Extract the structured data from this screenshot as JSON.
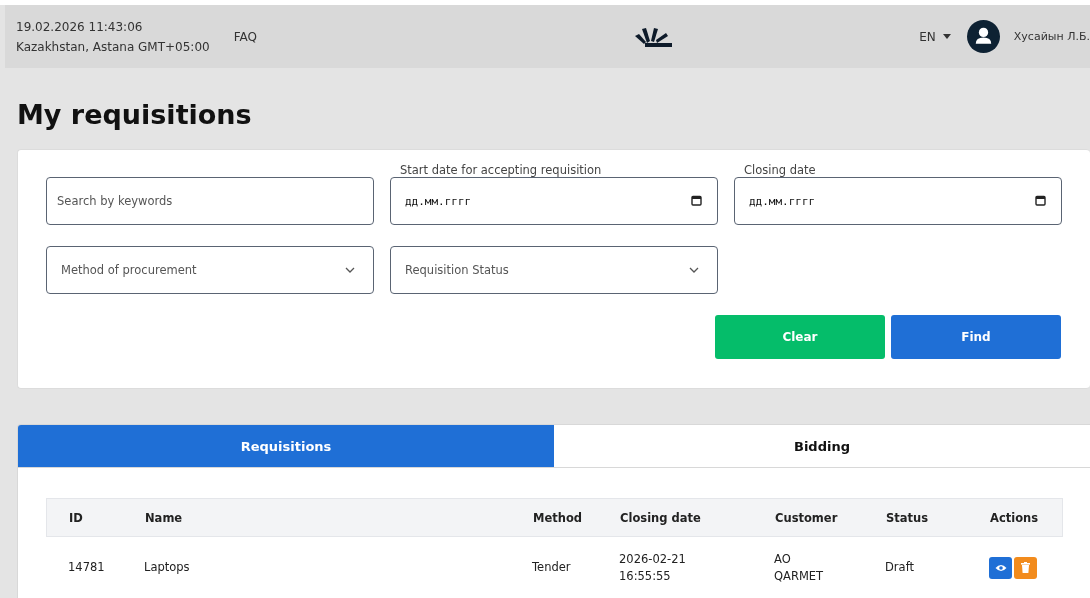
{
  "header": {
    "datetime": "19.02.2026 11:43:06",
    "timezone": "Kazakhstan, Astana GMT+05:00",
    "faq": "FAQ",
    "language": "EN",
    "user": "Хусайын Л.Б."
  },
  "title": "My requisitions",
  "filters": {
    "search": {
      "placeholder": "Search by keywords"
    },
    "start_date": {
      "label": "Start date for accepting requisition",
      "placeholder": "дд.мм.гггг"
    },
    "closing_date": {
      "label": "Closing date",
      "placeholder": "дд.мм.гггг"
    },
    "method": {
      "placeholder": "Method of procurement"
    },
    "status": {
      "placeholder": "Requisition Status"
    },
    "buttons": [
      {
        "label": "Clear",
        "kind": "clear"
      },
      {
        "label": "Find",
        "kind": "find"
      }
    ]
  },
  "tabs": [
    {
      "label": "Requisitions",
      "selected": true
    },
    {
      "label": "Bidding",
      "selected": false
    }
  ],
  "table": {
    "columns": [
      "ID",
      "Name",
      "Method",
      "Closing date",
      "Customer",
      "Status",
      "Actions"
    ],
    "rows": [
      {
        "cells": [
          "14781",
          "Laptops",
          "Tender",
          "2026-02-21\n16:55:55",
          "AO\nQARMET",
          "Draft"
        ]
      }
    ]
  }
}
